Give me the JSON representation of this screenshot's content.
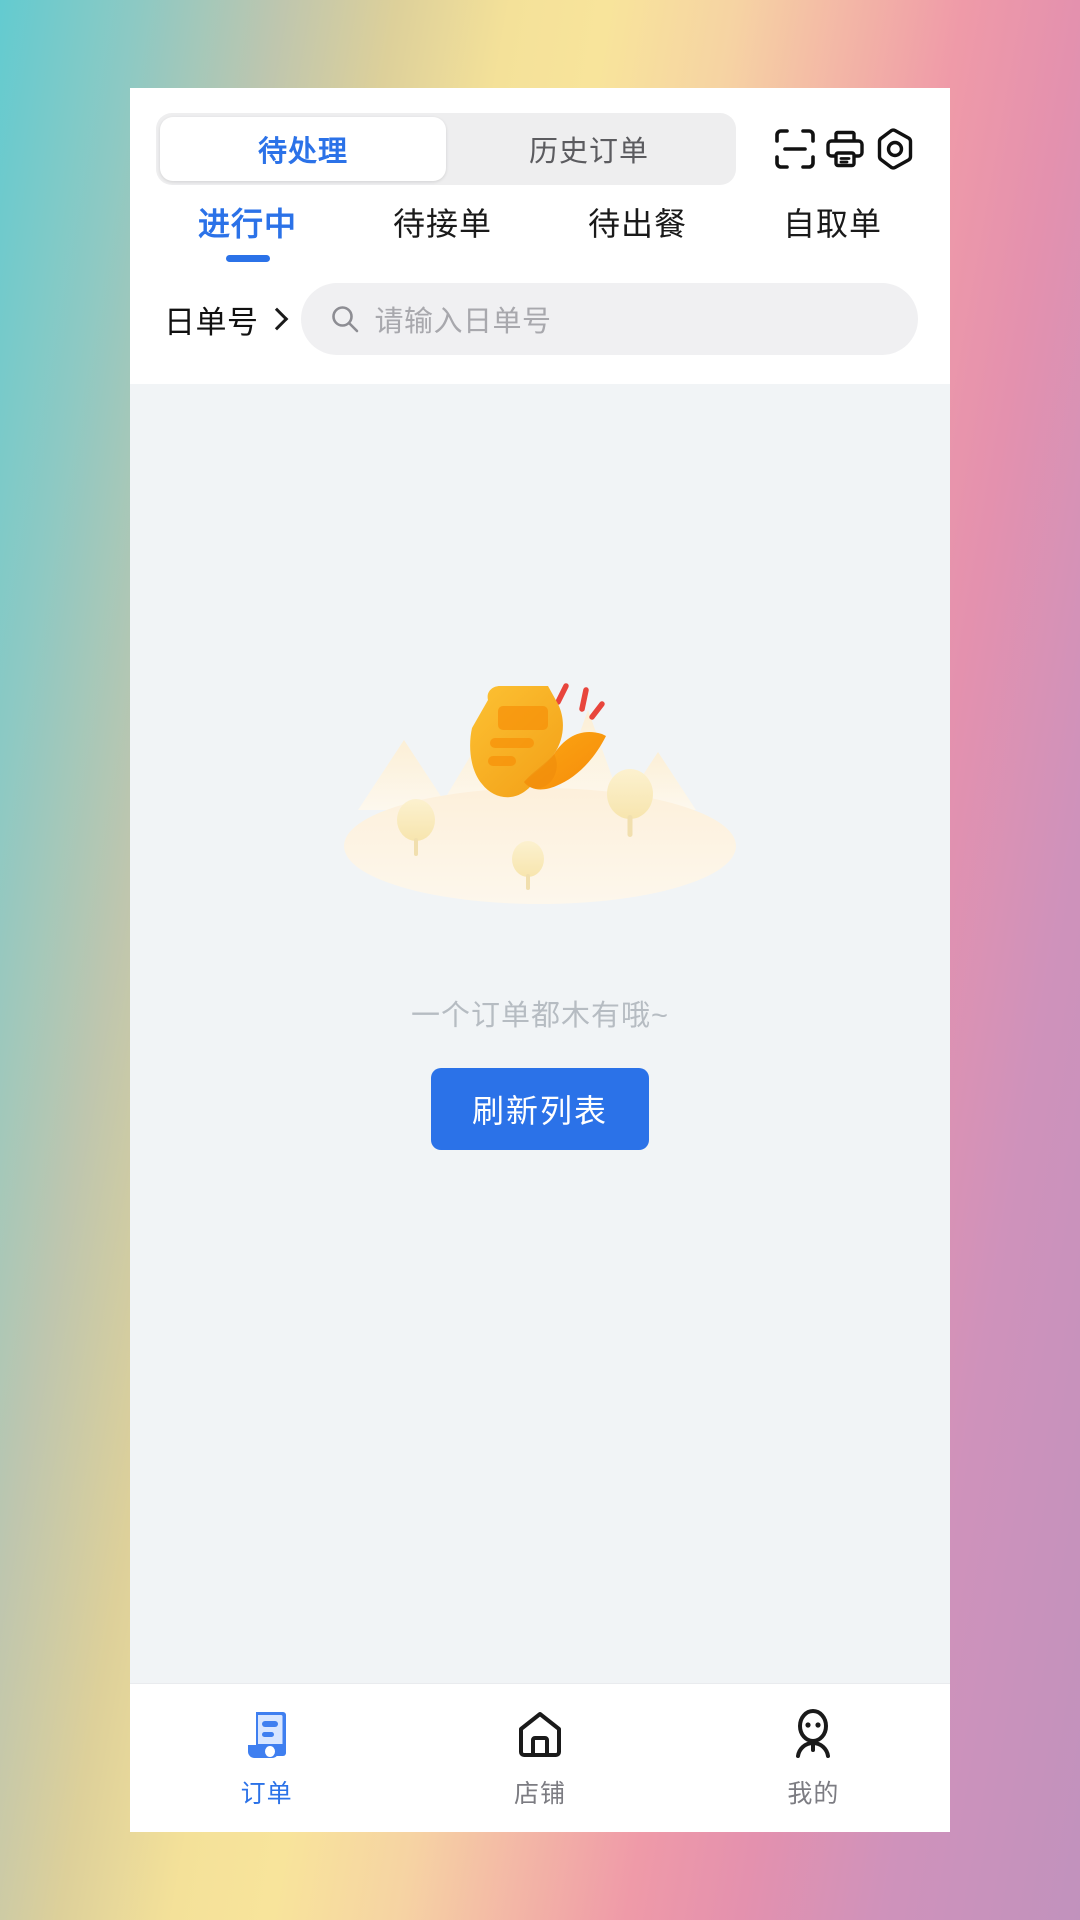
{
  "theme": {
    "accent": "#2b72e8",
    "content_bg": "#f1f4f6",
    "muted_text": "#b6bcc2",
    "illustration_primary": "#f5a623",
    "illustration_accent": "#e8453c"
  },
  "header": {
    "segments": [
      {
        "label": "待处理",
        "active": true
      },
      {
        "label": "历史订单",
        "active": false
      }
    ],
    "icons": [
      {
        "name": "scan-icon",
        "label": "扫码"
      },
      {
        "name": "printer-icon",
        "label": "打印"
      },
      {
        "name": "settings-icon",
        "label": "设置"
      }
    ]
  },
  "subtabs": [
    {
      "label": "进行中",
      "active": true
    },
    {
      "label": "待接单",
      "active": false
    },
    {
      "label": "待出餐",
      "active": false
    },
    {
      "label": "自取单",
      "active": false
    }
  ],
  "search": {
    "select_label": "日单号",
    "placeholder": "请输入日单号",
    "value": ""
  },
  "empty_state": {
    "message": "一个订单都木有哦~",
    "button_label": "刷新列表"
  },
  "bottom_nav": [
    {
      "label": "订单",
      "icon": "order-receipt-icon",
      "active": true
    },
    {
      "label": "店铺",
      "icon": "home-icon",
      "active": false
    },
    {
      "label": "我的",
      "icon": "person-icon",
      "active": false
    }
  ]
}
